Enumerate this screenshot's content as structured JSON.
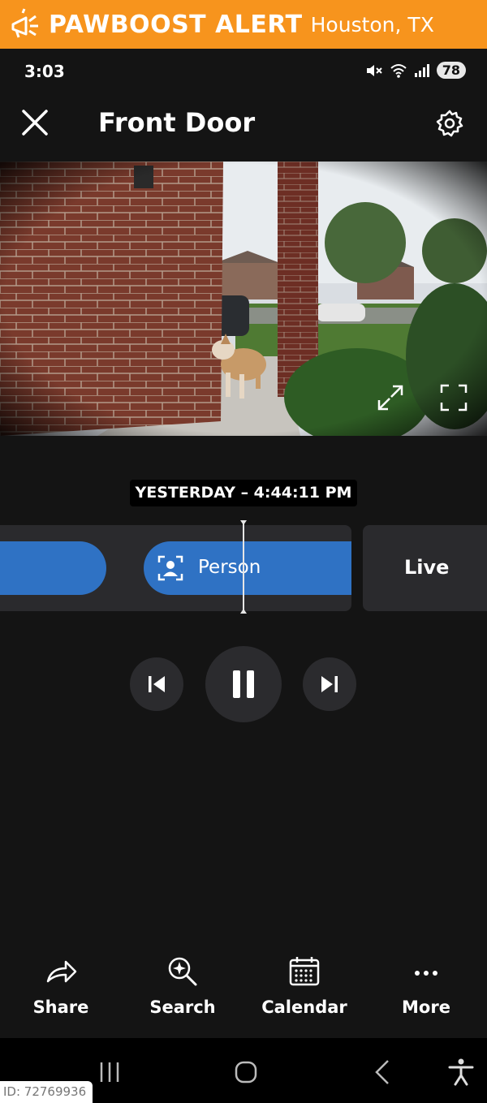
{
  "banner": {
    "title": "PAWBOOST ALERT",
    "location": "Houston, TX",
    "icon": "megaphone-icon",
    "color": "#f7941d"
  },
  "status_bar": {
    "time": "3:03",
    "battery": "78",
    "icons": [
      "mute-icon",
      "wifi-icon",
      "signal-icon"
    ]
  },
  "header": {
    "title": "Front Door",
    "close_icon": "close-icon",
    "settings_icon": "gear-icon"
  },
  "video": {
    "controls": [
      "expand-icon",
      "fullscreen-icon"
    ]
  },
  "timeline": {
    "timestamp": "YESTERDAY – 4:44:11 PM",
    "event_label": "Person",
    "live_label": "Live",
    "event_color": "#2f72c4"
  },
  "playback": {
    "buttons": [
      "skip-previous-icon",
      "pause-icon",
      "skip-next-icon"
    ]
  },
  "actions": [
    {
      "label": "Share",
      "icon": "share-icon"
    },
    {
      "label": "Search",
      "icon": "search-sparkle-icon"
    },
    {
      "label": "Calendar",
      "icon": "calendar-icon"
    },
    {
      "label": "More",
      "icon": "more-icon"
    }
  ],
  "nav_bar": {
    "icons": [
      "recents-icon",
      "home-icon",
      "back-icon",
      "accessibility-icon"
    ]
  },
  "watermark": {
    "id_text": "ID: 72769936"
  }
}
